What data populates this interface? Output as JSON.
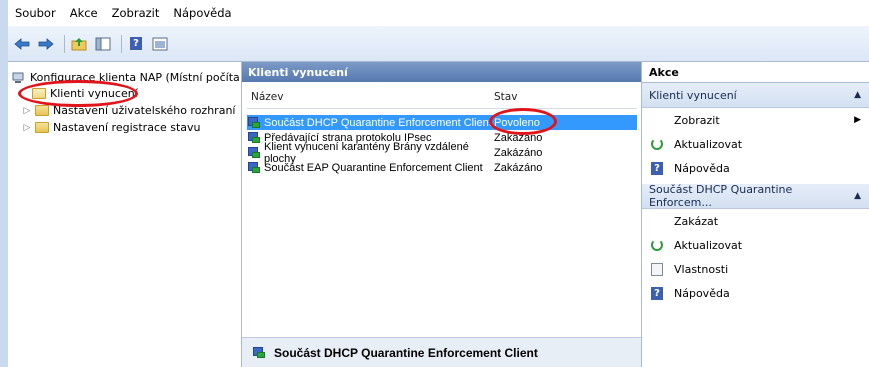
{
  "menu": [
    "Soubor",
    "Akce",
    "Zobrazit",
    "Nápověda"
  ],
  "toolbar": {
    "icons": [
      "back-arrow-icon",
      "forward-arrow-icon",
      "up-folder-icon",
      "show-hide-tree-icon",
      "help-icon",
      "properties-icon"
    ]
  },
  "tree": {
    "root_label": "Konfigurace klienta NAP (Místní počíta",
    "items": [
      {
        "label": "Klienti vynucení"
      },
      {
        "label": "Nastavení uživatelského rozhraní"
      },
      {
        "label": "Nastavení registrace stavu"
      }
    ]
  },
  "center": {
    "header": "Klienti vynucení",
    "columns": {
      "name": "Název",
      "status": "Stav"
    },
    "rows": [
      {
        "name": "Součást DHCP Quarantine Enforcement Client",
        "status": "Povoleno",
        "selected": true
      },
      {
        "name": "Předávající strana protokolu IPsec",
        "status": "Zakázáno",
        "selected": false
      },
      {
        "name": "Klient vynucení karantény Brány vzdálené plochy",
        "status": "Zakázáno",
        "selected": false
      },
      {
        "name": "Součást EAP Quarantine Enforcement Client",
        "status": "Zakázáno",
        "selected": false
      }
    ],
    "detail_title": "Součást DHCP Quarantine Enforcement Client"
  },
  "actions": {
    "title": "Akce",
    "section1": {
      "label": "Klienti vynucení",
      "items": [
        "Zobrazit",
        "Aktualizovat",
        "Nápověda"
      ]
    },
    "section2": {
      "label": "Součást DHCP Quarantine Enforcem...",
      "items": [
        "Zakázat",
        "Aktualizovat",
        "Vlastnosti",
        "Nápověda"
      ]
    }
  },
  "colors": {
    "selection": "#3399ff",
    "header": "#5679b1",
    "annotation": "#e1141c"
  }
}
